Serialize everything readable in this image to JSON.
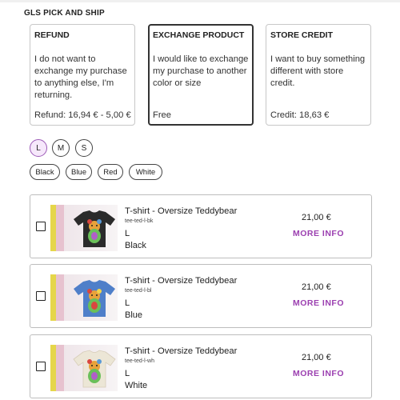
{
  "section_title": "GLS PICK AND SHIP",
  "options": [
    {
      "title": "REFUND",
      "description": "I do not want to exchange my purchase to anything else, I'm returning.",
      "price": "Refund: 16,94 €  - 5,00 €",
      "selected": false
    },
    {
      "title": "EXCHANGE PRODUCT",
      "description": "I would like to exchange my purchase to another color or size",
      "price": "Free",
      "selected": true
    },
    {
      "title": "STORE CREDIT",
      "description": "I want to buy something different with store credit.",
      "price": "Credit: 18,63 €",
      "selected": false
    }
  ],
  "sizes": [
    "L",
    "M",
    "S"
  ],
  "selected_size": "L",
  "colors": [
    "Black",
    "Blue",
    "Red",
    "White"
  ],
  "products": [
    {
      "name": "T-shirt - Oversize Teddybear",
      "sku": "tee-ted-l-bk",
      "size": "L",
      "color": "Black",
      "price": "21,00 €",
      "more_info": "MORE INFO",
      "image_icon": "black-tshirt-teddybear-image"
    },
    {
      "name": "T-shirt - Oversize Teddybear",
      "sku": "tee-ted-l-bl",
      "size": "L",
      "color": "Blue",
      "price": "21,00 €",
      "more_info": "MORE INFO",
      "image_icon": "blue-tshirt-teddybear-image"
    },
    {
      "name": "T-shirt - Oversize Teddybear",
      "sku": "tee-ted-l-wh",
      "size": "L",
      "color": "White",
      "price": "21,00 €",
      "more_info": "MORE INFO",
      "image_icon": "white-tshirt-teddybear-image"
    }
  ],
  "colors_hex": {
    "accent_purple": "#9b3fb0",
    "selected_chip_bg": "#f6e8fb",
    "tshirt_black": "#2b2b2b",
    "tshirt_blue": "#4f7fc9",
    "tshirt_white": "#ece6d6"
  }
}
